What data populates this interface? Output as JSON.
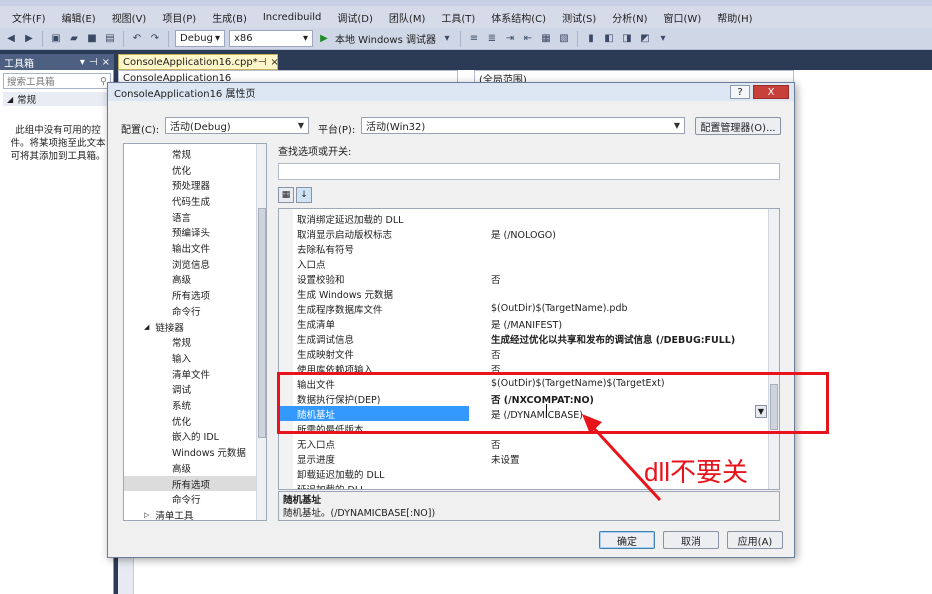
{
  "menubar": {
    "items": [
      "文件(F)",
      "编辑(E)",
      "视图(V)",
      "项目(P)",
      "生成(B)",
      "Incredibuild",
      "调试(D)",
      "团队(M)",
      "工具(T)",
      "体系结构(C)",
      "测试(S)",
      "分析(N)",
      "窗口(W)",
      "帮助(H)"
    ]
  },
  "toolbar": {
    "config": "Debug",
    "platform": "x86",
    "debugger": "本地 Windows 调试器"
  },
  "toolbox": {
    "title": "工具箱",
    "search_placeholder": "搜索工具箱",
    "group": "常规",
    "empty_text": "此组中没有可用的控件。将某项拖至此文本可将其添加到工具箱。"
  },
  "editor": {
    "tab": "ConsoleApplication16.cpp*",
    "nav_left": "ConsoleApplication16",
    "nav_right": "(全局范围)"
  },
  "dialog": {
    "title": "ConsoleApplication16 属性页",
    "help": "?",
    "close": "X",
    "config_label": "配置(C):",
    "config_value": "活动(Debug)",
    "platform_label": "平台(P):",
    "platform_value": "活动(Win32)",
    "config_manager": "配置管理器(O)...",
    "search_label": "查找选项或开关:",
    "tree": [
      {
        "label": "常规",
        "indent": 2
      },
      {
        "label": "优化",
        "indent": 2
      },
      {
        "label": "预处理器",
        "indent": 2
      },
      {
        "label": "代码生成",
        "indent": 2
      },
      {
        "label": "语言",
        "indent": 2
      },
      {
        "label": "预编译头",
        "indent": 2
      },
      {
        "label": "输出文件",
        "indent": 2
      },
      {
        "label": "浏览信息",
        "indent": 2
      },
      {
        "label": "高级",
        "indent": 2
      },
      {
        "label": "所有选项",
        "indent": 2
      },
      {
        "label": "命令行",
        "indent": 2
      },
      {
        "label": "链接器",
        "indent": 1,
        "expander": "◢"
      },
      {
        "label": "常规",
        "indent": 2
      },
      {
        "label": "输入",
        "indent": 2
      },
      {
        "label": "清单文件",
        "indent": 2
      },
      {
        "label": "调试",
        "indent": 2
      },
      {
        "label": "系统",
        "indent": 2
      },
      {
        "label": "优化",
        "indent": 2
      },
      {
        "label": "嵌入的 IDL",
        "indent": 2
      },
      {
        "label": "Windows 元数据",
        "indent": 2
      },
      {
        "label": "高级",
        "indent": 2
      },
      {
        "label": "所有选项",
        "indent": 2,
        "selected": true
      },
      {
        "label": "命令行",
        "indent": 2
      },
      {
        "label": "清单工具",
        "indent": 1,
        "expander": "▷"
      }
    ],
    "grid": [
      {
        "name": "取消绑定延迟加载的 DLL",
        "value": ""
      },
      {
        "name": "取消显示启动版权标志",
        "value": "是 (/NOLOGO)"
      },
      {
        "name": "去除私有符号",
        "value": ""
      },
      {
        "name": "入口点",
        "value": ""
      },
      {
        "name": "设置校验和",
        "value": "否"
      },
      {
        "name": "生成 Windows 元数据",
        "value": ""
      },
      {
        "name": "生成程序数据库文件",
        "value": "$(OutDir)$(TargetName).pdb"
      },
      {
        "name": "生成清单",
        "value": "是 (/MANIFEST)"
      },
      {
        "name": "生成调试信息",
        "value": "生成经过优化以共享和发布的调试信息 (/DEBUG:FULL)",
        "bold": true
      },
      {
        "name": "生成映射文件",
        "value": "否"
      },
      {
        "name": "使用库依赖项输入",
        "value": "否"
      },
      {
        "name": "输出文件",
        "value": "$(OutDir)$(TargetName)$(TargetExt)"
      },
      {
        "name": "数据执行保护(DEP)",
        "value": "否 (/NXCOMPAT:NO)",
        "bold": true
      },
      {
        "name": "随机基址",
        "value": "是 (/DYNAMICBASE)",
        "selected": true
      },
      {
        "name": "所需的最低版本",
        "value": ""
      },
      {
        "name": "无入口点",
        "value": "否"
      },
      {
        "name": "显示进度",
        "value": "未设置"
      },
      {
        "name": "卸载延迟加载的 DLL",
        "value": ""
      },
      {
        "name": "延迟加载的 DLL",
        "value": ""
      }
    ],
    "desc_title": "随机基址",
    "desc_text": "随机基址。(/DYNAMICBASE[:NO])",
    "ok": "确定",
    "cancel": "取消",
    "apply": "应用(A)"
  },
  "annotation": {
    "text": "dll不要关",
    "color": "#e8141c"
  }
}
